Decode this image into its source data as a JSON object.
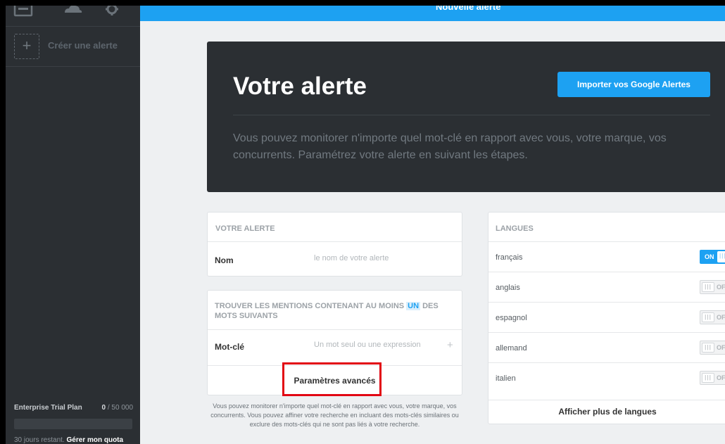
{
  "sidebar": {
    "top_icons": [
      "inbox-icon",
      "cloud-icon",
      "gear-icon"
    ],
    "create_label": "Créer une alerte",
    "plan": {
      "name": "Enterprise Trial Plan",
      "used": "0",
      "quota": " / 50 000",
      "usage_fraction": 0,
      "days_left": "30 jours restant.",
      "manage_label": "Gérer mon quota"
    }
  },
  "topbar": {
    "title": "Nouvelle alerte"
  },
  "hero": {
    "title": "Votre alerte",
    "import_button": "Importer vos Google Alertes",
    "description": "Vous pouvez monitorer n'importe quel mot-clé en rapport avec vous, votre marque, vos concurrents. Paramétrez votre alerte en suivant les étapes."
  },
  "alert_card": {
    "header": "VOTRE ALERTE",
    "name_label": "Nom",
    "name_placeholder": "le nom de votre alerte"
  },
  "mentions_card": {
    "header_before": "TROUVER LES MENTIONS CONTENANT AU MOINS ",
    "header_highlight": "UN",
    "header_after": " DES MOTS SUIVANTS",
    "keyword_label": "Mot-clé",
    "keyword_placeholder": "Un mot seul ou une expression",
    "advanced_label": "Paramètres avancés"
  },
  "note": "Vous pouvez monitorer n'importe quel mot-clé en rapport avec vous, votre marque, vos concurrents. Vous pouvez affiner votre recherche en incluant des mots-clés similaires ou exclure des mots-clés qui ne sont pas liés à votre recherche.",
  "languages": {
    "header": "LANGUES",
    "items": [
      {
        "name": "français",
        "state": "ON",
        "on": true
      },
      {
        "name": "anglais",
        "state": "OFF",
        "on": false
      },
      {
        "name": "espagnol",
        "state": "OFF",
        "on": false
      },
      {
        "name": "allemand",
        "state": "OFF",
        "on": false
      },
      {
        "name": "italien",
        "state": "OFF",
        "on": false
      }
    ],
    "more_label": "Afficher plus de langues"
  },
  "colors": {
    "accent": "#1da1f2",
    "sidebar": "#2b2f33",
    "highlight_box": "#e20613"
  }
}
